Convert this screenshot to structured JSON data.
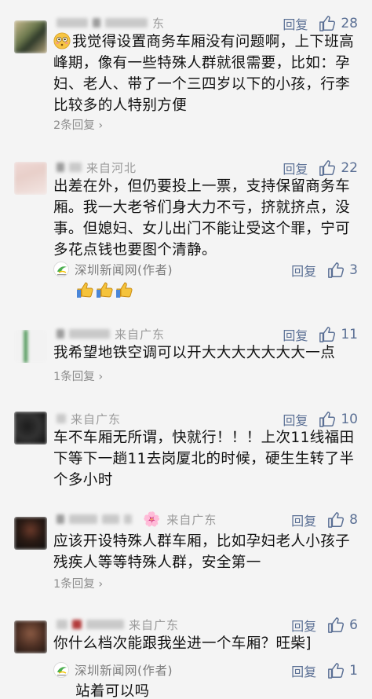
{
  "ui": {
    "reply_label": "回复",
    "like_color": "#5a6f94"
  },
  "comments": [
    {
      "location": "东",
      "likes": "28",
      "text": "我觉得设置商务车厢没有问题啊，上下班高峰期，像有一些特殊人群就很需要，比如：孕妇、老人、带了一个三四岁以下的小孩，行李比较多的人特别方便",
      "more_replies": "2条回复",
      "leading_emoji": "flushed-face-icon"
    },
    {
      "location": "来自河北",
      "likes": "22",
      "text": "出差在外，但仍要投上一票，支持保留商务车厢。我一大老爷们身大力不亏，挤就挤点，没事。但媳妇、女儿出门不能让受这个罪，宁可多花点钱也要图个清静。",
      "author_reply": {
        "name": "深圳新闻网(作者)",
        "likes": "3",
        "emoji": "thumbs-up-icon"
      }
    },
    {
      "location": "来自广东",
      "likes": "11",
      "text": "我希望地铁空调可以开大大大大大大大一点",
      "more_replies": "1条回复"
    },
    {
      "location": "来自广东",
      "likes": "10",
      "text": "车不车厢无所谓，快就行！！！上次11线福田下等下一趟11去岗厦北的时候，硬生生转了半个多小时"
    },
    {
      "location": "来自广东",
      "likes": "8",
      "text": "应该开设特殊人群车厢，比如孕妇老人小孩子残疾人等等特殊人群，安全第一",
      "more_replies": "1条回复"
    },
    {
      "location": "来自广东",
      "likes": "6",
      "text": "你什么档次能跟我坐进一个车厢？旺柴]",
      "author_reply": {
        "name": "深圳新闻网(作者)",
        "likes": "1",
        "text": "站着可以吗"
      }
    }
  ]
}
